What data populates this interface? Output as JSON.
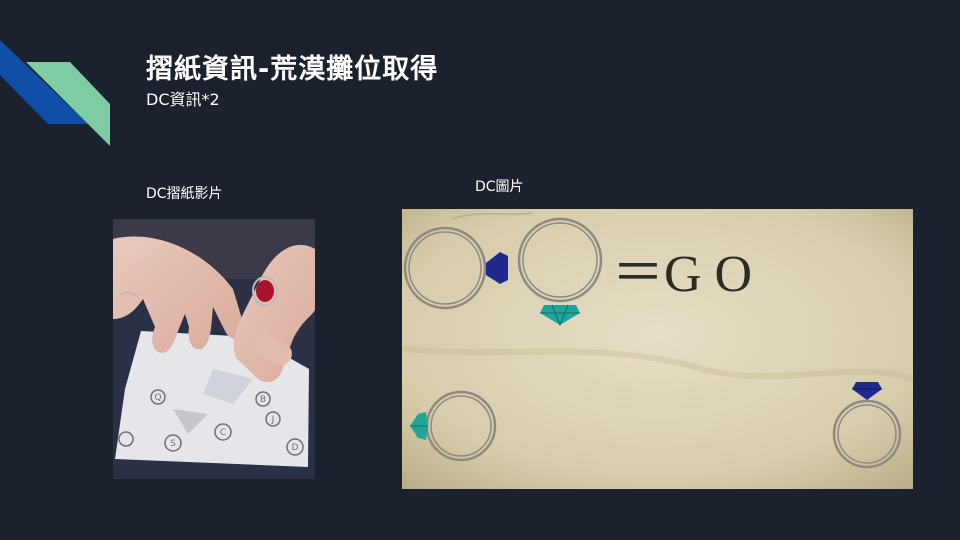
{
  "slide": {
    "title": "摺紙資訊-荒漠攤位取得",
    "subtitle": "DC資訊*2"
  },
  "left_panel": {
    "label": "DC摺紙影片",
    "image_alt": "hands folding a sheet of paper printed with circled letters"
  },
  "right_panel": {
    "label": "DC圖片",
    "equation_text": "＝G O",
    "image_alt": "rings with blue and teal gems on aged parchment"
  },
  "colors": {
    "background": "#1b212d",
    "accent_blue": "#0f4fa8",
    "accent_green": "#7ecba4",
    "sapphire": "#1f2a8c",
    "emerald": "#1fa59a",
    "parchment": "#ddd3b5"
  },
  "icons": {
    "decoration": "diagonal-stripes-icon",
    "sapphire": "sapphire-gem-icon",
    "emerald": "emerald-gem-icon",
    "ring": "ring-icon"
  }
}
